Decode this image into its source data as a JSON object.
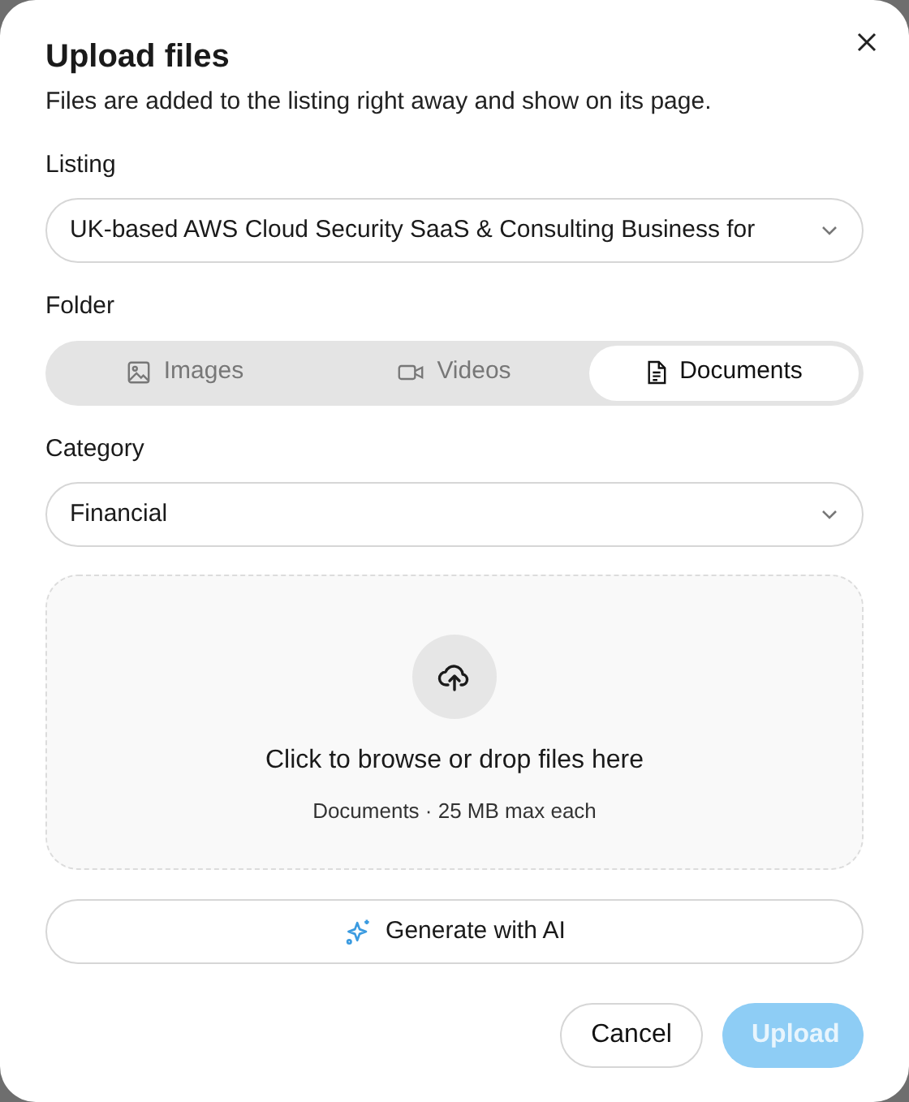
{
  "dialog": {
    "title": "Upload files",
    "description": "Files are added to the listing right away and show on its page."
  },
  "listing": {
    "label": "Listing",
    "value": "UK-based AWS Cloud Security SaaS & Consulting Business for"
  },
  "folder": {
    "label": "Folder",
    "tabs": [
      {
        "label": "Images",
        "kind": "image",
        "selected": false
      },
      {
        "label": "Videos",
        "kind": "video",
        "selected": false
      },
      {
        "label": "Documents",
        "kind": "document",
        "selected": true
      }
    ]
  },
  "category": {
    "label": "Category",
    "value": "Financial"
  },
  "dropzone": {
    "text": "Click to browse or drop files here",
    "hint": "Documents · 25 MB max each"
  },
  "ai_button": {
    "label": "Generate with AI"
  },
  "buttons": [
    {
      "label": "Cancel",
      "kind": "secondary",
      "disabled": false
    },
    {
      "label": "Upload",
      "kind": "primary",
      "disabled": true
    }
  ]
}
